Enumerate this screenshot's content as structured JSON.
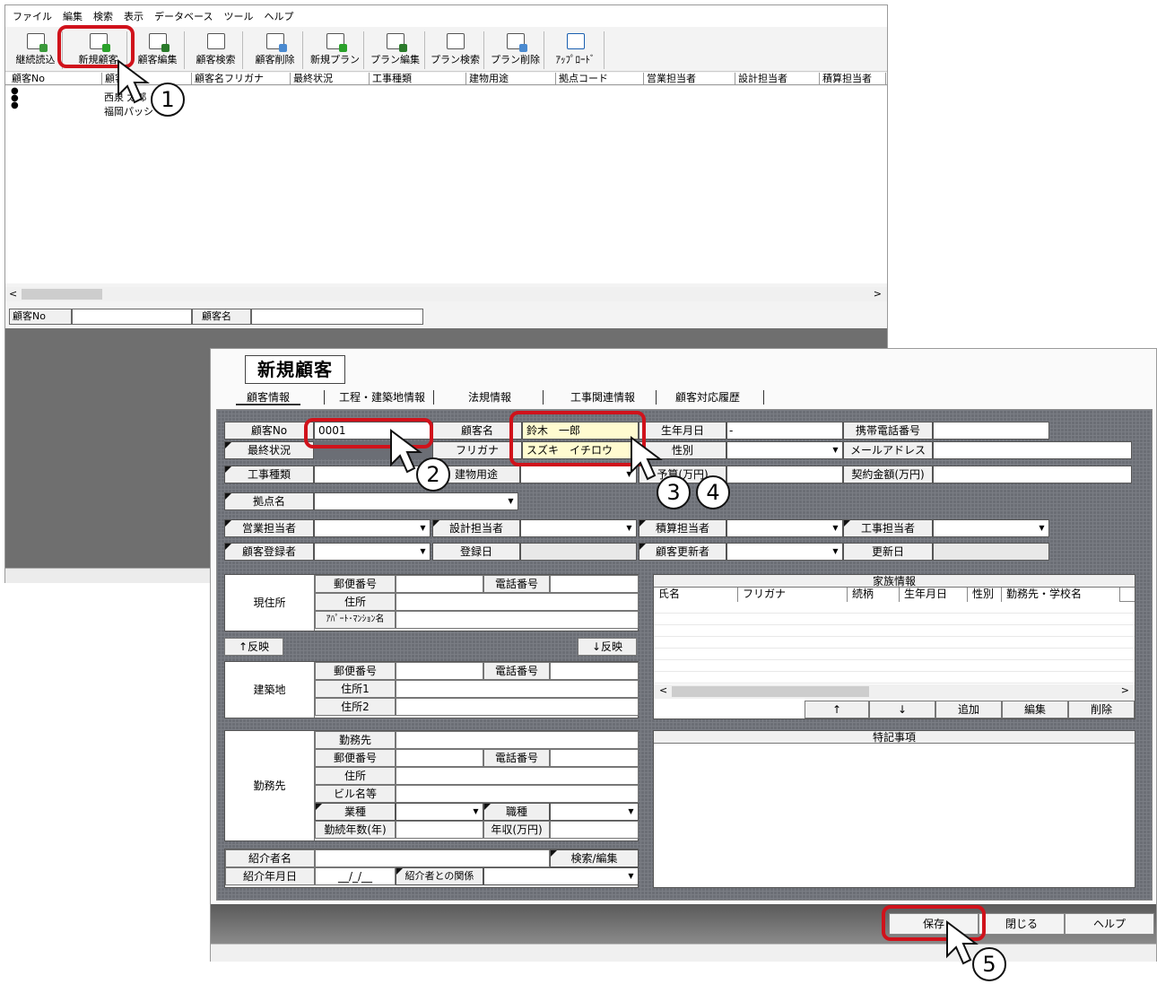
{
  "menu": [
    "ファイル",
    "編集",
    "検索",
    "表示",
    "データベース",
    "ツール",
    "ヘルプ"
  ],
  "toolbar": [
    "継続読込",
    "新規顧客",
    "顧客編集",
    "顧客検索",
    "顧客削除",
    "新規プラン",
    "プラン編集",
    "プラン検索",
    "プラン削除",
    "ｱｯﾌﾟﾛｰﾄﾞ"
  ],
  "grid": {
    "columns": [
      "顧客No",
      "顧客名",
      "顧客名フリガナ",
      "最終状況",
      "工事種類",
      "建物用途",
      "拠点コード",
      "営業担当者",
      "設計担当者",
      "積算担当者"
    ],
    "rows": [
      "西泉 太郎",
      "福岡パッシ"
    ]
  },
  "filter": {
    "no_label": "顧客No",
    "name_label": "顧客名"
  },
  "form": {
    "title": "新規顧客",
    "tabs": [
      "顧客情報",
      "工程・建築地情報",
      "法規情報",
      "工事関連情報",
      "顧客対応履歴"
    ],
    "labels": {
      "customer_no": "顧客No",
      "final_status": "最終状況",
      "construction_type": "工事種類",
      "base_name": "拠点名",
      "sales_rep": "営業担当者",
      "customer_reg": "顧客登録者",
      "customer_name": "顧客名",
      "furigana": "フリガナ",
      "building_use": "建物用途",
      "design_rep": "設計担当者",
      "reg_date": "登録日",
      "birth": "生年月日",
      "gender": "性別",
      "budget": "予算(万円)",
      "estimate_rep": "積算担当者",
      "updater": "顧客更新者",
      "mobile": "携帯電話番号",
      "email": "メールアドレス",
      "contract": "契約金額(万円)",
      "construction_rep": "工事担当者",
      "update_date": "更新日"
    },
    "values": {
      "customer_no": "0001",
      "customer_name": "鈴木　一郎",
      "furigana": "スズキ　イチロウ",
      "birth_dash": "-"
    },
    "address": {
      "current": "現住所",
      "build": "建築地",
      "work": "勤務先",
      "postal": "郵便番号",
      "phone": "電話番号",
      "addr": "住所",
      "apt": "ｱﾊﾟｰﾄ･ﾏﾝｼｮﾝ名",
      "addr1": "住所1",
      "addr2": "住所2",
      "reflect_up": "↑反映",
      "reflect_down": "↓反映",
      "workplace": "勤務先",
      "building": "ビル名等",
      "industry": "業種",
      "job": "職種",
      "years": "勤続年数(年)",
      "income": "年収(万円)"
    },
    "family": {
      "title": "家族情報",
      "cols": [
        "氏名",
        "フリガナ",
        "続柄",
        "生年月日",
        "性別",
        "勤務先・学校名"
      ],
      "up": "↑",
      "down": "↓",
      "add": "追加",
      "edit": "編集",
      "delete": "削除"
    },
    "notes": "特記事項",
    "referrer": {
      "name": "紹介者名",
      "date": "紹介年月日",
      "date_value": "__/_/__",
      "relation": "紹介者との関係",
      "search": "検索/編集"
    },
    "buttons": {
      "save": "保存",
      "close": "閉じる",
      "help": "ヘルプ"
    }
  },
  "steps": [
    "1",
    "2",
    "3",
    "4",
    "5"
  ],
  "colors": {
    "highlight": "#d0121b",
    "panel": "#6b6e75",
    "field_yellow": "#fffbd0"
  }
}
